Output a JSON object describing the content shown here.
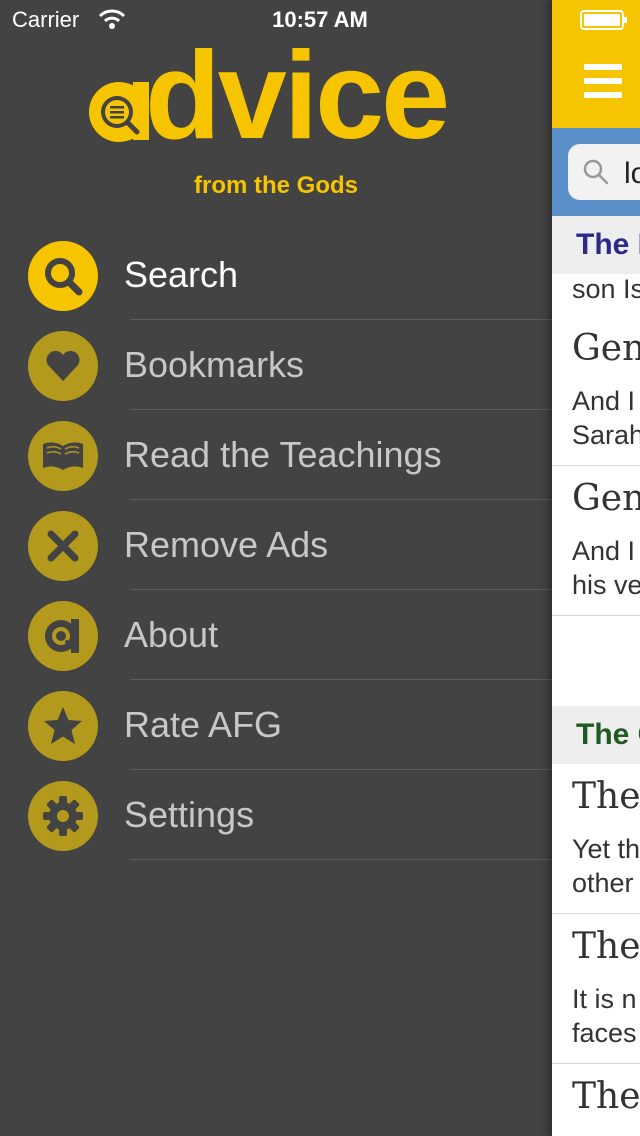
{
  "status_bar": {
    "carrier": "Carrier",
    "time": "10:57 AM"
  },
  "logo": {
    "word": "dvice",
    "tagline": "from the Gods"
  },
  "colors": {
    "accent": "#f6c500",
    "drawer_bg": "#434343",
    "icon_inactive": "#b39a1c",
    "search_bg": "#5b8fc9"
  },
  "menu": {
    "items": [
      {
        "label": "Search",
        "icon": "search-icon",
        "active": true
      },
      {
        "label": "Bookmarks",
        "icon": "heart-icon"
      },
      {
        "label": "Read the Teachings",
        "icon": "book-icon"
      },
      {
        "label": "Remove Ads",
        "icon": "close-icon"
      },
      {
        "label": "About",
        "icon": "advice-logo-icon"
      },
      {
        "label": "Rate AFG",
        "icon": "star-icon"
      },
      {
        "label": "Settings",
        "icon": "gear-icon"
      }
    ]
  },
  "main": {
    "search_text": "lo",
    "sections": [
      {
        "title": "The B",
        "title_color": "#2a2a8c",
        "partial_line": "son Is",
        "results": [
          {
            "title": "Gen",
            "lines": [
              "And I",
              "Sarah"
            ]
          },
          {
            "title": "Gen",
            "lines": [
              "And I",
              "his ve"
            ]
          }
        ]
      },
      {
        "title": "The C",
        "title_color": "#1f5a22",
        "results": [
          {
            "title": "The",
            "lines": [
              "Yet th",
              "other"
            ]
          },
          {
            "title": "The",
            "lines": [
              "It is n",
              "faces"
            ]
          },
          {
            "title": "The",
            "lines": []
          }
        ]
      }
    ]
  }
}
